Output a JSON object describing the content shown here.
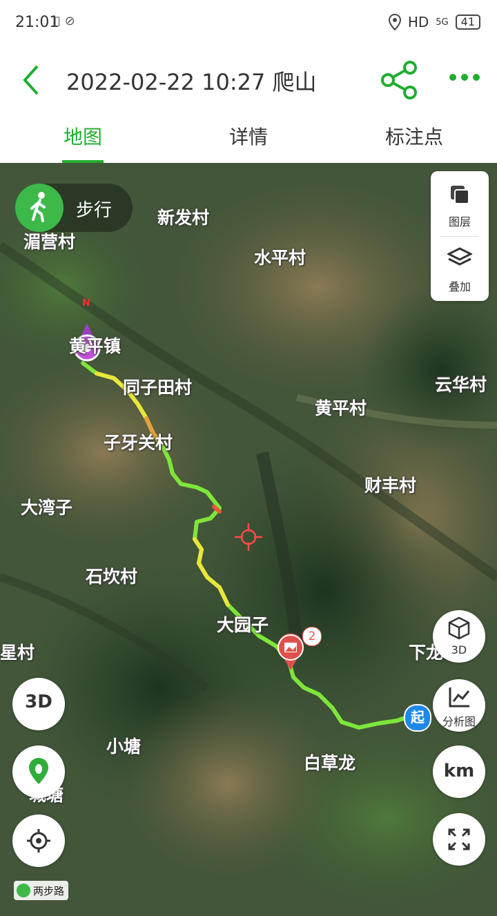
{
  "status_bar": {
    "time": "21:01",
    "network": "HD",
    "signal": "5G",
    "battery": "41"
  },
  "header": {
    "title": "2022-02-22 10:27 爬山"
  },
  "tabs": [
    {
      "label": "地图",
      "active": true
    },
    {
      "label": "详情",
      "active": false
    },
    {
      "label": "标注点",
      "active": false
    }
  ],
  "map": {
    "mode_label": "步行",
    "north_label": "N",
    "places": [
      "新发村",
      "水平村",
      "湄营村",
      "黄平镇",
      "同子田村",
      "云华村",
      "黄平村",
      "子牙关村",
      "财丰村",
      "大湾子",
      "石坎村",
      "大园子",
      "下龙",
      "星村",
      "小塘",
      "白草龙",
      "城塘"
    ],
    "photo_count": "2",
    "start_label": "起",
    "layer_buttons": [
      "图层",
      "叠加"
    ],
    "right_buttons": [
      "3D",
      "分析图",
      "km"
    ],
    "left_buttons": [
      "3D",
      "足迹",
      "定位"
    ],
    "logo_text": "两步路",
    "accent_color": "#1fae2e",
    "track_colors": [
      "#7ee63a",
      "#e8e63a",
      "#e85a3a"
    ]
  }
}
